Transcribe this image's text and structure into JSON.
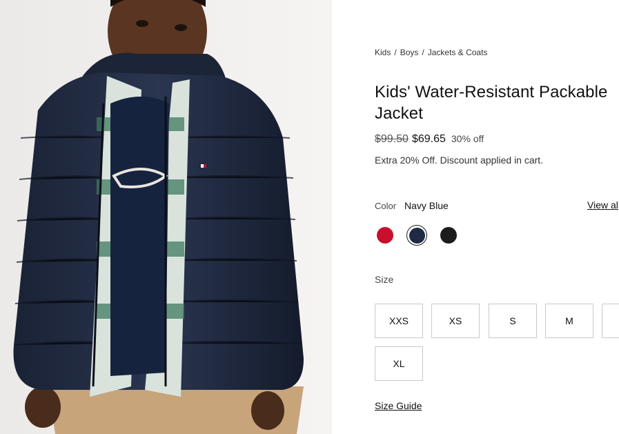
{
  "product_image": {
    "alt": "Boy wearing navy puffer jacket",
    "background": "#f1efed"
  },
  "breadcrumb": [
    {
      "label": "Kids"
    },
    {
      "label": "Boys"
    },
    {
      "label": "Jackets & Coats"
    }
  ],
  "breadcrumb_separator": "/",
  "product": {
    "title": "Kids' Water-Resistant Packable Jacket",
    "price_original": "$99.50",
    "price_sale": "$69.65",
    "discount": "30% off",
    "promo": "Extra 20% Off. Discount applied in cart."
  },
  "color": {
    "label": "Color",
    "selected": "Navy Blue",
    "view_all": "View al",
    "swatches": [
      {
        "name": "Red",
        "hex": "#c8102e",
        "selected": false
      },
      {
        "name": "Navy Blue",
        "hex": "#1f2a44",
        "selected": true
      },
      {
        "name": "Black",
        "hex": "#1c1c1c",
        "selected": false
      }
    ]
  },
  "size": {
    "label": "Size",
    "options": [
      "XXS",
      "XS",
      "S",
      "M",
      "",
      "XL"
    ],
    "guide_label": "Size Guide"
  }
}
